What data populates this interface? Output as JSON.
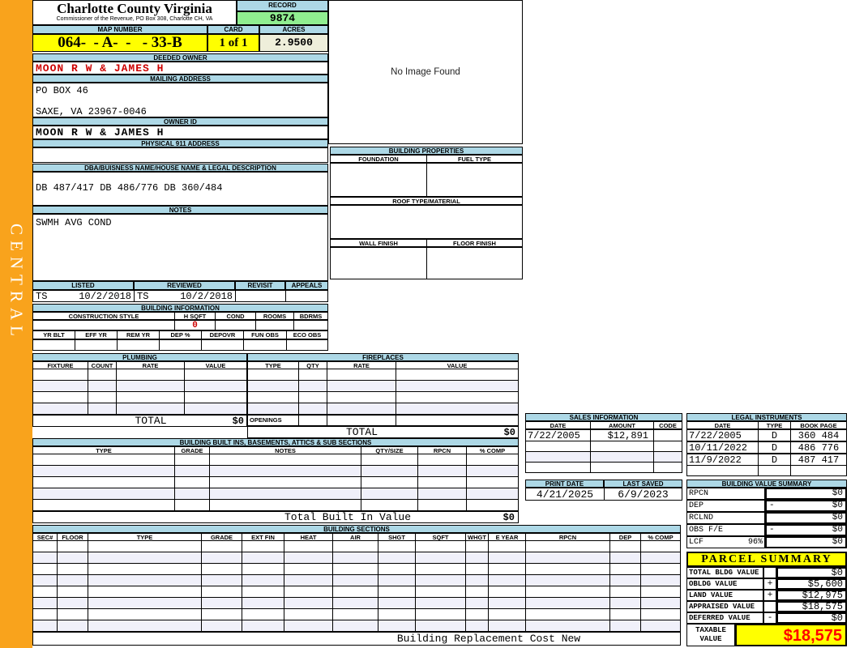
{
  "colors": {
    "accent_orange": "#F9A31C",
    "band_blue": "#ADD8E6",
    "highlight_yellow": "#FFFF00",
    "record_green": "#90EE90",
    "acres_cream": "#EEEEDA",
    "owner_red": "#CC0000",
    "taxable_red": "#FF0000",
    "alt_row": "#F0F0FA"
  },
  "sidebar": {
    "region": "CENTRAL"
  },
  "header": {
    "title": "Charlotte County Virginia",
    "subtitle": "Commissioner of the Revenue, PO Box 308, Charlotte CH, VA",
    "record_label": "RECORD",
    "record_value": "9874",
    "map_number_label": "MAP NUMBER",
    "map_number_value": "064-  - A-  -   - 33-B",
    "card_label": "CARD",
    "card_value": "1 of 1",
    "acres_label": "ACRES",
    "acres_value": "2.9500"
  },
  "owner": {
    "deeded_owner_label": "DEEDED OWNER",
    "deeded_owner": "MOON R W & JAMES H",
    "mailing_address_label": "MAILING ADDRESS",
    "mailing_line1": "PO BOX 46",
    "mailing_line2": "SAXE, VA 23967-0046",
    "owner_id_label": "OWNER ID",
    "owner_id": "MOON R W & JAMES H",
    "physical_address_label": "PHYSICAL 911 ADDRESS",
    "physical_address": ""
  },
  "dba": {
    "label": "DBA/BUISNESS NAME/HOUSE NAME & LEGAL DESCRIPTION",
    "value": "DB 487/417 DB 486/776 DB 360/484"
  },
  "notes": {
    "label": "NOTES",
    "value": "SWMH AVG COND"
  },
  "visits": {
    "listed_label": "LISTED",
    "reviewed_label": "REVIEWED",
    "revisit_label": "REVISIT",
    "appeals_label": "APPEALS",
    "listed_by": "TS",
    "listed_date": "10/2/2018",
    "reviewed_by": "TS",
    "reviewed_date": "10/2/2018",
    "revisit": "",
    "appeals": ""
  },
  "building_information": {
    "title": "BUILDING INFORMATION",
    "style_headers": [
      "CONSTRUCTION STYLE",
      "H SQFT",
      "COND",
      "ROOMS",
      "BDRMS"
    ],
    "construction_style": "",
    "h_sqft": "0",
    "cond": "",
    "rooms": "",
    "bdrms": "",
    "year_headers": [
      "YR BLT",
      "EFF YR",
      "REM YR",
      "DEP %",
      "DEPOVR",
      "FUN OBS",
      "ECO OBS"
    ]
  },
  "plumbing": {
    "title": "PLUMBING",
    "headers": [
      "FIXTURE",
      "COUNT",
      "RATE",
      "VALUE"
    ],
    "total_label": "TOTAL",
    "total_value": "$0"
  },
  "fireplaces": {
    "title": "FIREPLACES",
    "headers": [
      "TYPE",
      "QTY",
      "RATE",
      "VALUE"
    ],
    "openings_label": "OPENINGS",
    "total_label": "TOTAL",
    "total_value": "$0"
  },
  "built_ins": {
    "title": "BUILDING BUILT INS, BASEMENTS, ATTICS & SUB SECTIONS",
    "headers": [
      "TYPE",
      "GRADE",
      "NOTES",
      "QTY/SIZE",
      "RPCN",
      "% COMP"
    ],
    "total_label": "Total Built In Value",
    "total_value": "$0"
  },
  "building_sections": {
    "title": "BUILDING SECTIONS",
    "headers": [
      "SEC#",
      "FLOOR",
      "TYPE",
      "GRADE",
      "EXT FIN",
      "HEAT",
      "AIR",
      "SHGT",
      "SQFT",
      "WHGT",
      "E YEAR",
      "RPCN",
      "DEP",
      "% COMP"
    ],
    "footer_label": "Building Replacement Cost New"
  },
  "image_panel": {
    "text": "No Image Found"
  },
  "building_properties": {
    "title": "BUILDING PROPERTIES",
    "foundation_label": "FOUNDATION",
    "fuel_type_label": "FUEL TYPE",
    "roof_label": "ROOF TYPE/MATERIAL",
    "wall_finish_label": "WALL FINISH",
    "floor_finish_label": "FLOOR FINISH"
  },
  "sales_information": {
    "title": "SALES INFORMATION",
    "headers": [
      "DATE",
      "AMOUNT",
      "CODE"
    ],
    "rows": [
      {
        "date": "7/22/2005",
        "amount": "$12,891",
        "code": ""
      }
    ]
  },
  "legal_instruments": {
    "title": "LEGAL INSTRUMENTS",
    "headers": [
      "DATE",
      "TYPE",
      "BOOK PAGE"
    ],
    "rows": [
      {
        "date": "7/22/2005",
        "type": "D",
        "book_page": "360 484"
      },
      {
        "date": "10/11/2022",
        "type": "D",
        "book_page": "486 776"
      },
      {
        "date": "11/9/2022",
        "type": "D",
        "book_page": "487 417"
      }
    ]
  },
  "print_info": {
    "print_date_label": "PRINT DATE",
    "print_date": "4/21/2025",
    "last_saved_label": "LAST SAVED",
    "last_saved": "6/9/2023"
  },
  "building_value_summary": {
    "title": "BUILDING VALUE SUMMARY",
    "rows": [
      {
        "label": "RPCN",
        "op": "",
        "value": "$0"
      },
      {
        "label": "DEP",
        "op": "-",
        "value": "$0"
      },
      {
        "label": "RCLND",
        "op": "",
        "value": "$0"
      },
      {
        "label": "OBS F/E",
        "op": "-",
        "value": "$0"
      }
    ],
    "lcf_label": "LCF",
    "lcf_pct": "96%",
    "lcf_op": "",
    "lcf_value": "$0"
  },
  "parcel_summary": {
    "title": "PARCEL SUMMARY",
    "rows": [
      {
        "label": "TOTAL BLDG VALUE",
        "op": "",
        "value": "$0"
      },
      {
        "label": "OBLDG VALUE",
        "op": "+",
        "value": "$5,600"
      },
      {
        "label": "LAND VALUE",
        "op": "+",
        "value": "$12,975"
      },
      {
        "label": "APPRAISED VALUE",
        "op": "",
        "value": "$18,575"
      },
      {
        "label": "DEFERRED VALUE",
        "op": "-",
        "value": "$0"
      }
    ],
    "taxable_label": "TAXABLE VALUE",
    "taxable_value": "$18,575"
  }
}
